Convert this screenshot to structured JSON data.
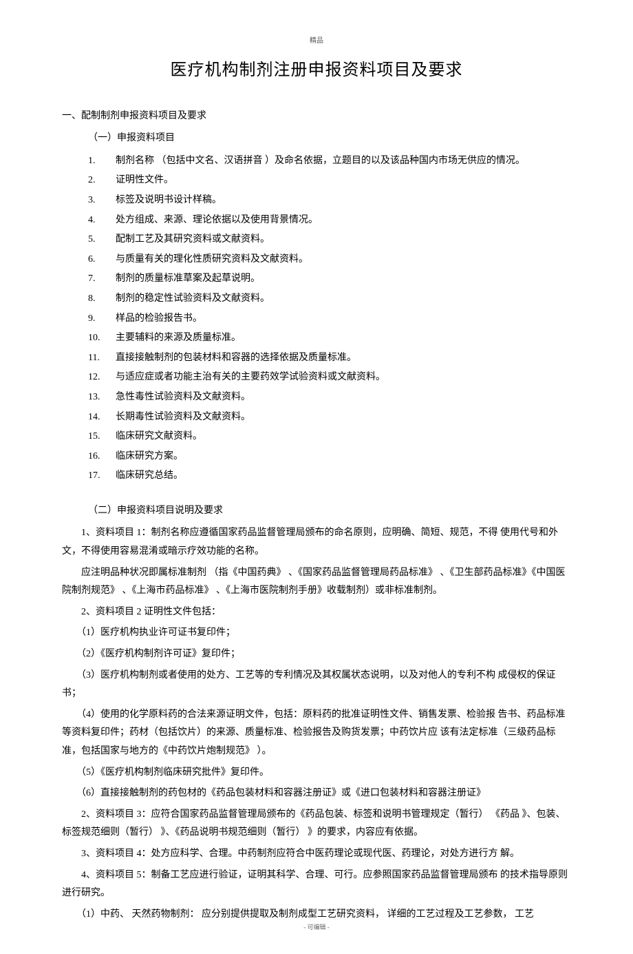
{
  "header": "精品",
  "title": "医疗机构制剂注册申报资料项目及要求",
  "section1": {
    "heading": "一、配制制剂申报资料项目及要求",
    "sub1": "（一）申报资料项目",
    "items": [
      {
        "n": "1.",
        "t": "制剂名称 （包括中文名、汉语拼音 ）及命名依据，立题目的以及该品种国内市场无供应的情况。"
      },
      {
        "n": "2.",
        "t": "证明性文件。"
      },
      {
        "n": "3.",
        "t": "标签及说明书设计样稿。"
      },
      {
        "n": "4.",
        "t": "处方组成、来源、理论依据以及使用背景情况。"
      },
      {
        "n": "5.",
        "t": "配制工艺及其研究资料或文献资料。"
      },
      {
        "n": "6.",
        "t": "与质量有关的理化性质研究资料及文献资料。"
      },
      {
        "n": "7.",
        "t": "制剂的质量标准草案及起草说明。"
      },
      {
        "n": "8.",
        "t": "制剂的稳定性试验资料及文献资料。"
      },
      {
        "n": "9.",
        "t": "样品的检验报告书。"
      },
      {
        "n": "10.",
        "t": "主要辅料的来源及质量标准。"
      },
      {
        "n": "11.",
        "t": "直接接触制剂的包装材料和容器的选择依据及质量标准。"
      },
      {
        "n": "12.",
        "t": "与适应症或者功能主治有关的主要药效学试验资料或文献资料。"
      },
      {
        "n": "13.",
        "t": "急性毒性试验资料及文献资料。"
      },
      {
        "n": "14.",
        "t": "长期毒性试验资料及文献资料。"
      },
      {
        "n": "15.",
        "t": "临床研究文献资料。"
      },
      {
        "n": "16.",
        "t": "临床研究方案。"
      },
      {
        "n": "17.",
        "t": "临床研究总结。"
      }
    ],
    "sub2": "（二）申报资料项目说明及要求",
    "paras": [
      "　　1、资料项目 1：制剂名称应遵循国家药品监督管理局颁布的命名原则，应明确、简短、规范，不得 使用代号和外文，不得使用容易混淆或暗示疗效功能的名称。",
      "　　应注明品种状况即属标准制剂 （指《中国药典》 、《国家药品监督管理局药品标准》 、《卫生部药品标准》《中国医院制剂规范》 、《上海市药品标准》 、《上海市医院制剂手册》收载制剂）或非标准制剂。",
      "　　2、资料项目 2 证明性文件包括：",
      "　　（1）医疗机构执业许可证书复印件；",
      "　　（2）《医疗机构制剂许可证》复印件；",
      "　　（3）医疗机构制剂或者使用的处方、工艺等的专利情况及其权属状态说明，以及对他人的专利不构 成侵权的保证书；",
      "　　（4）使用的化学原料药的合法来源证明文件，包括：原料药的批准证明性文件、销售发票、检验报 告书、药品标准等资料复印件；药材（包括饮片）的来源、质量标准、检验报告及购货发票；中药饮片应 该有法定标准（三级药品标准，包括国家与地方的《中药饮片炮制规范》 ）。",
      "　　（5）《医疗机构制剂临床研究批件》复印件。",
      "　　（6）直接接触制剂的药包材的《药品包装材料和容器注册证》或《进口包装材料和容器注册证》",
      "　　2、资料项目 3：应符合国家药品监督管理局颁布的《药品包装、标签和说明书管理规定（暂行） 《药品 》、包装、标签规范细则（暂行） 》、《药品说明书规范细则（暂行） 》的要求，内容应有依据。",
      "　　3、资料项目 4：处方应科学、合理。中药制剂应符合中医药理论或现代医、药理论，对处方进行方 解。",
      "　　4、资料项目 5：制备工艺应进行验证，证明其科学、合理、可行。应参照国家药品监督管理局颁布 的技术指导原则进行研究。",
      "　　（1）中药、 天然药物制剂： 应分别提供提取及制剂成型工艺研究资料， 详细的工艺过程及工艺参数， 工艺"
    ]
  },
  "footer": "- 可编辑 -"
}
